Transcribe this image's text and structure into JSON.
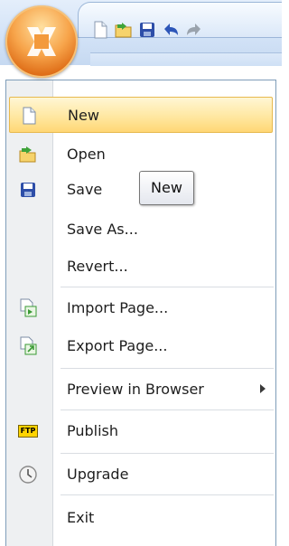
{
  "app_button": {
    "icon": "office-orb-icon"
  },
  "quick_access": [
    {
      "icon": "new-document-icon"
    },
    {
      "icon": "open-folder-icon"
    },
    {
      "icon": "save-disk-icon"
    },
    {
      "icon": "undo-icon"
    },
    {
      "icon": "redo-icon"
    }
  ],
  "menu": {
    "items": [
      {
        "label": "New",
        "icon": "new-document-icon"
      },
      {
        "label": "Open",
        "icon": "open-folder-icon"
      },
      {
        "label": "Save",
        "icon": "save-disk-icon"
      },
      {
        "label": "Save As...",
        "icon": ""
      },
      {
        "label": "Revert...",
        "icon": ""
      },
      {
        "label": "Import Page...",
        "icon": "import-page-icon"
      },
      {
        "label": "Export Page...",
        "icon": "export-page-icon"
      },
      {
        "label": "Preview in Browser",
        "icon": "",
        "submenu": true
      },
      {
        "label": "Publish",
        "icon": "ftp-icon",
        "badge": "FTP"
      },
      {
        "label": "Upgrade",
        "icon": "clock-icon"
      },
      {
        "label": "Exit",
        "icon": ""
      }
    ]
  },
  "tooltip": {
    "text": "New"
  },
  "colors": {
    "highlight": "#ffe9a6",
    "orb": "#e0701a",
    "chrome": "#d3e3f7"
  }
}
